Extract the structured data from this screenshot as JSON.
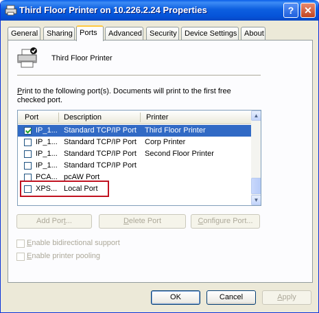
{
  "window": {
    "title": "Third Floor Printer on 10.226.2.24 Properties",
    "help_glyph": "?",
    "close_glyph": "✕"
  },
  "tabs": [
    {
      "label": "General"
    },
    {
      "label": "Sharing"
    },
    {
      "label": "Ports",
      "active": true
    },
    {
      "label": "Advanced"
    },
    {
      "label": "Security"
    },
    {
      "label": "Device Settings"
    },
    {
      "label": "About"
    }
  ],
  "printer_name": "Third Floor Printer",
  "instructions": {
    "mnemonic": "P",
    "rest": "rint to the following port(s). Documents will print to the first free checked port."
  },
  "ports_table": {
    "headers": {
      "port": "Port",
      "description": "Description",
      "printer": "Printer"
    },
    "rows": [
      {
        "port": "IP_1...",
        "description": "Standard TCP/IP Port",
        "printer": "Third Floor Printer",
        "checked": true,
        "selected": true
      },
      {
        "port": "IP_1...",
        "description": "Standard TCP/IP Port",
        "printer": "Corp Printer",
        "checked": false
      },
      {
        "port": "IP_1...",
        "description": "Standard TCP/IP Port",
        "printer": "Second Floor Printer",
        "checked": false
      },
      {
        "port": "IP_1...",
        "description": "Standard TCP/IP Port",
        "printer": "",
        "checked": false
      },
      {
        "port": "PCA...",
        "description": "pcAW Port",
        "printer": "",
        "checked": false
      },
      {
        "port": "XPS...",
        "description": "Local Port",
        "printer": "",
        "checked": false,
        "highlighted": true
      }
    ]
  },
  "port_buttons": {
    "add": {
      "pre": "Add Por",
      "mn": "t",
      "post": "..."
    },
    "delete": {
      "pre": "",
      "mn": "D",
      "post": "elete Port"
    },
    "configure": {
      "pre": "",
      "mn": "C",
      "post": "onfigure Port..."
    }
  },
  "options": {
    "bidirectional": {
      "mn": "E",
      "rest": "nable bidirectional support",
      "checked": false,
      "enabled": false
    },
    "pooling": {
      "mn": "E",
      "rest": "nable printer pooling",
      "checked": false,
      "enabled": false
    }
  },
  "dialog_buttons": {
    "ok": "OK",
    "cancel": "Cancel",
    "apply": {
      "mn": "A",
      "rest": "pply"
    }
  },
  "colors": {
    "title_bar": "#0553d8",
    "selection": "#316ac5",
    "highlight_outline": "#c0101e",
    "dialog_bg": "#ece9d8"
  }
}
